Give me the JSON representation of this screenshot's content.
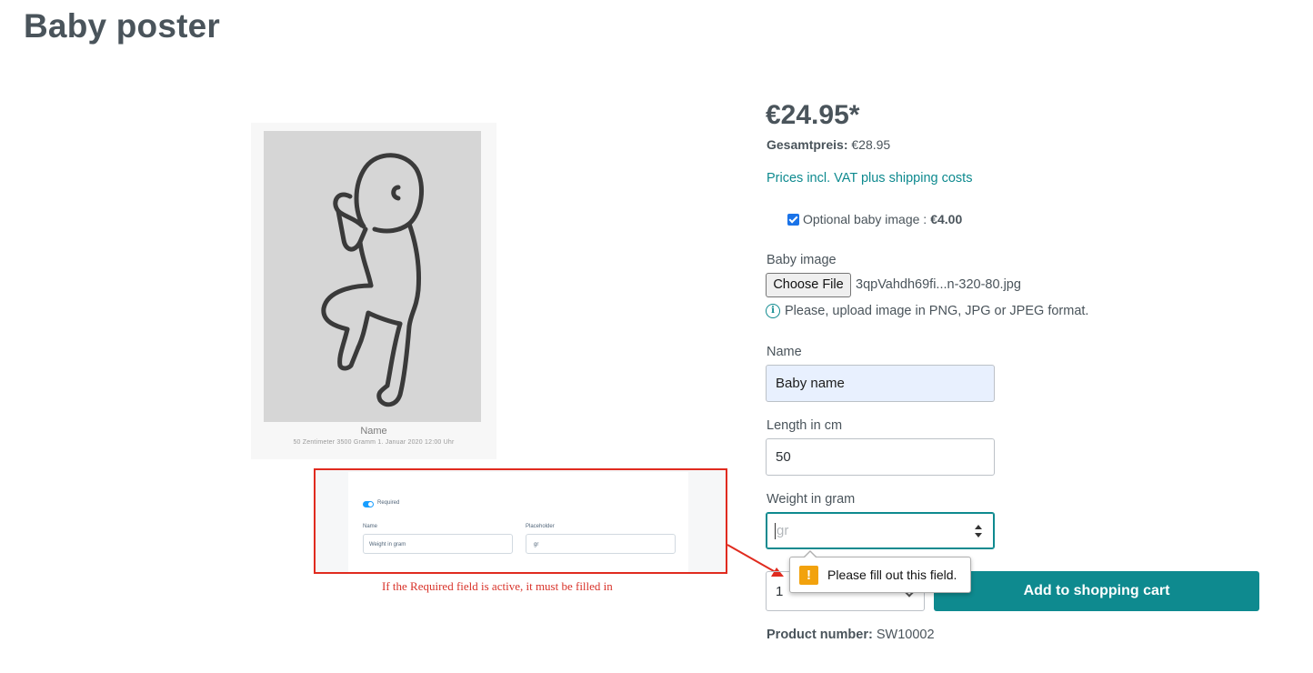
{
  "page": {
    "title": "Baby poster"
  },
  "poster": {
    "name": "Name",
    "meta": "50 Zentimeter   3500 Gramm   1. Januar 2020   12:00 Uhr"
  },
  "annotation": {
    "toggle_label": "Required",
    "field1_label": "Name",
    "field1_value": "Weight in gram",
    "field2_label": "Placeholder",
    "field2_value": "gr",
    "caption": "If the Required field is active, it must be filled in",
    "color": "#e02b1f"
  },
  "buybox": {
    "price": "€24.95*",
    "total_label": "Gesamtpreis:",
    "total_value": "€28.95",
    "vat_link": "Prices incl. VAT plus shipping costs",
    "option_label": "Optional baby image : ",
    "option_price": "€4.00",
    "option_checked": true,
    "image_label": "Baby image",
    "file_button": "Choose File",
    "file_name": "3qpVahdh69fi...n-320-80.jpg",
    "hint": "Please, upload image in PNG, JPG or JPEG format.",
    "name_label": "Name",
    "name_value": "Baby name",
    "length_label": "Length in cm",
    "length_value": "50",
    "weight_label": "Weight in gram",
    "weight_placeholder": "gr",
    "tooltip": "Please fill out this field.",
    "quantity": "1",
    "cart_button": "Add to shopping cart",
    "product_number_label": "Product number:",
    "product_number_value": "SW10002",
    "accent_color": "#0e8a8f"
  }
}
